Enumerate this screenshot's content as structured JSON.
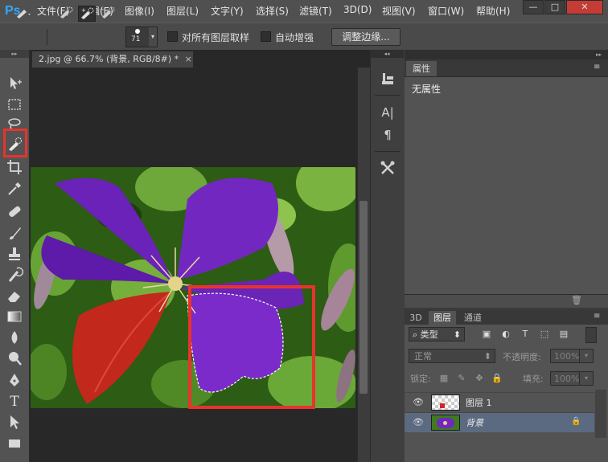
{
  "app": {
    "logo": "Ps"
  },
  "menu": [
    "文件(F)",
    "编辑(E)",
    "图像(I)",
    "图层(L)",
    "文字(Y)",
    "选择(S)",
    "滤镜(T)",
    "3D(D)",
    "视图(V)",
    "窗口(W)",
    "帮助(H)"
  ],
  "window_controls": {
    "minimize": "—",
    "restore": "□",
    "close": "✕"
  },
  "options_bar": {
    "brush_size": "71",
    "sample_all_layers_label": "对所有图层取样",
    "sample_all_layers_checked": false,
    "auto_enhance_label": "自动增强",
    "auto_enhance_checked": false,
    "refine_edge_button": "调整边缘..."
  },
  "document": {
    "tab_title": "2.jpg @ 66.7% (背景, RGB/8#) *",
    "close_symbol": "×"
  },
  "toolbar": {
    "active_tool": "quick-selection-tool",
    "highlight_color": "#e8332d",
    "tools": [
      "move-tool",
      "marquee-tool",
      "lasso-tool",
      "quick-selection-tool",
      "crop-tool",
      "eyedropper-tool",
      "healing-brush-tool",
      "brush-tool",
      "clone-stamp-tool",
      "history-brush-tool",
      "eraser-tool",
      "gradient-tool",
      "blur-tool",
      "dodge-tool",
      "pen-tool",
      "type-tool",
      "path-selection-tool",
      "rectangle-tool"
    ]
  },
  "dock": {
    "icons": [
      "history-icon",
      "character-icon",
      "paragraph-icon",
      "tool-presets-icon"
    ],
    "character_glyph": "A|",
    "paragraph_glyph": "¶"
  },
  "properties_panel": {
    "tab": "属性",
    "empty_text": "无属性"
  },
  "layers_panel": {
    "tabs": [
      "3D",
      "图层",
      "通道"
    ],
    "active_tab": "图层",
    "filter_label": "类型",
    "blend_mode": "正常",
    "opacity_label": "不透明度:",
    "opacity_value": "100%",
    "lock_label": "锁定:",
    "fill_label": "填充:",
    "fill_value": "100%",
    "layers": [
      {
        "name": "图层 1",
        "selected": false,
        "locked": false
      },
      {
        "name": "背景",
        "selected": true,
        "locked": true
      }
    ],
    "selected_row_color": "#5b6a80"
  }
}
